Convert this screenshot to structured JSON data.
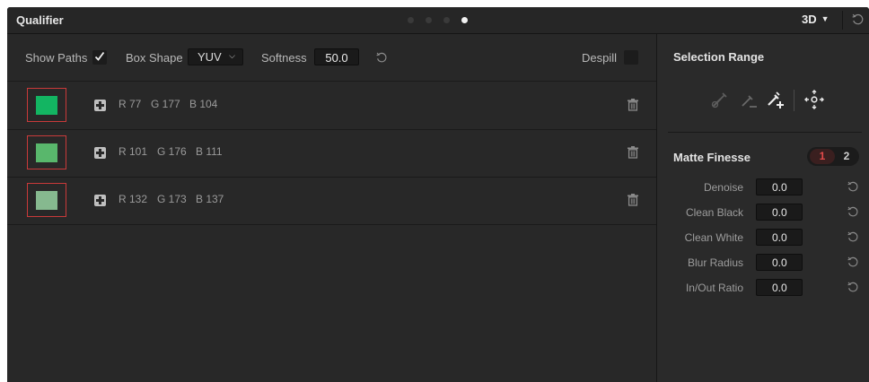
{
  "header": {
    "title": "Qualifier",
    "mode": "3D",
    "page_dots": 4,
    "active_page": 4
  },
  "toolbar": {
    "show_paths_label": "Show Paths",
    "show_paths_checked": true,
    "box_shape_label": "Box Shape",
    "box_shape_value": "YUV",
    "softness_label": "Softness",
    "softness_value": "50.0",
    "despill_label": "Despill",
    "despill_checked": false
  },
  "rows": [
    {
      "color": "#4db168",
      "r_label": "R 77",
      "g_label": "G 177",
      "b_label": "B 104"
    },
    {
      "color": "#65b06f",
      "r_label": "R 101",
      "g_label": "G 176",
      "b_label": "B 111"
    },
    {
      "color": "#84ad89",
      "r_label": "R 132",
      "g_label": "G 173",
      "b_label": "B 137"
    }
  ],
  "selection_range": {
    "title": "Selection Range",
    "tools": [
      "picker-icon",
      "picker-minus-icon",
      "picker-plus-icon",
      "expand-icon"
    ]
  },
  "matte_finesse": {
    "title": "Matte Finesse",
    "pages": [
      "1",
      "2"
    ],
    "active_page": "1",
    "params": [
      {
        "label": "Denoise",
        "value": "0.0"
      },
      {
        "label": "Clean Black",
        "value": "0.0"
      },
      {
        "label": "Clean White",
        "value": "0.0"
      },
      {
        "label": "Blur Radius",
        "value": "0.0"
      },
      {
        "label": "In/Out Ratio",
        "value": "0.0"
      }
    ]
  },
  "colors": {
    "background": "#282828",
    "accent_red": "#c93a3a",
    "text": "#b8b8b8"
  }
}
